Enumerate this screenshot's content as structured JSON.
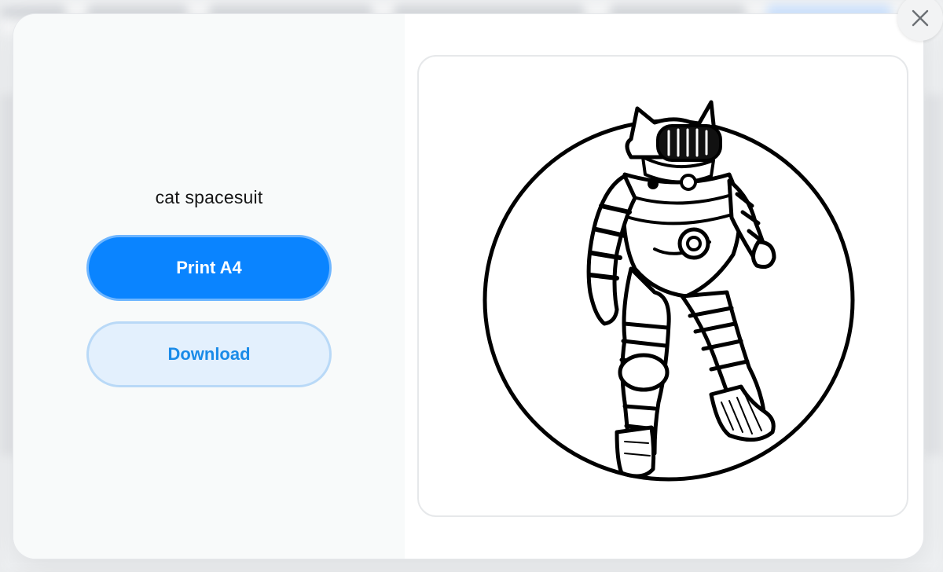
{
  "dialog": {
    "title": "cat spacesuit",
    "print_label": "Print A4",
    "download_label": "Download"
  },
  "preview": {
    "image_subject": "cat-astronaut-coloring-page"
  },
  "icons": {
    "close": "close-icon"
  },
  "colors": {
    "primary": "#0a84ff",
    "download_text": "#1a8be8",
    "download_bg": "#e3f0fd"
  }
}
